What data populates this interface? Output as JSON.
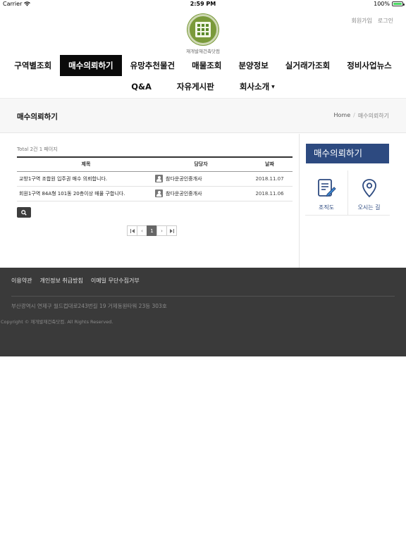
{
  "status_bar": {
    "carrier": "Carrier",
    "time": "2:59 PM",
    "battery": "100%"
  },
  "header": {
    "signup": "회원가입",
    "login": "로그인",
    "logo_text": "재개발재건축닷컴"
  },
  "nav": {
    "row1": [
      "구역별조회",
      "매수의뢰하기",
      "유망추천물건",
      "매물조회",
      "분양정보",
      "실거래가조회",
      "정비사업뉴스"
    ],
    "row2": [
      "Q&A",
      "자유게시판",
      "회사소개"
    ],
    "active": "매수의뢰하기"
  },
  "subheader": {
    "title": "매수의뢰하기",
    "breadcrumb_home": "Home",
    "breadcrumb_sep": "/",
    "breadcrumb_current": "매수의뢰하기"
  },
  "board": {
    "total": "Total 2건 1 페이지",
    "columns": [
      "제목",
      "담당자",
      "날짜"
    ],
    "rows": [
      {
        "subject": "교방1구역 조합원 입주권 매수 의뢰합니다.",
        "agent": "참다운공인중개사",
        "date": "2018.11.07"
      },
      {
        "subject": "회원1구역 84A형 101동 20층이상 매물 구합니다.",
        "agent": "참다운공인중개사",
        "date": "2018.11.06"
      }
    ],
    "pagination": {
      "first": "⏮",
      "prev": "‹",
      "current": "1",
      "next": "›",
      "last": "⏭"
    }
  },
  "sidebar": {
    "title": "매수의뢰하기",
    "links": [
      {
        "label": "조직도",
        "icon": "edit-document-icon"
      },
      {
        "label": "오시는 길",
        "icon": "map-pin-icon"
      }
    ]
  },
  "footer": {
    "links": [
      "이용약관",
      "개인정보 취급방침",
      "이메일 무단수집거부"
    ],
    "address": "부산광역시 연제구 월드컵대로243번길 19 거제동원타워 23등 303호",
    "copyright": "Copyright © 재개발재건축닷컴. All Rights Reserved."
  },
  "colors": {
    "sidebar_title_bg": "#2d4a80",
    "footer_bg": "#3a3a3a",
    "active_nav_bg": "#0a0a0a"
  }
}
